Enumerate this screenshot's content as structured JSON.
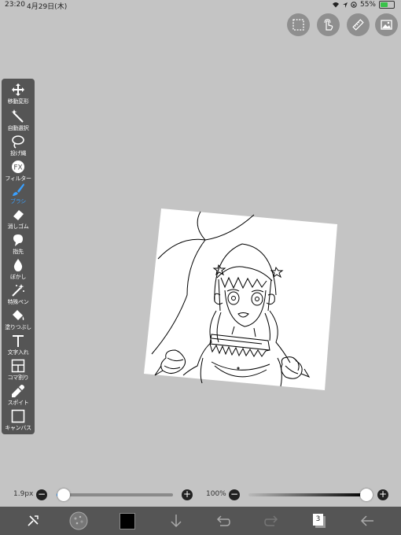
{
  "status": {
    "time": "23:20",
    "date": "4月29日(木)",
    "battery": "55%",
    "battery_level": 0.55
  },
  "top_buttons": [
    "selection-icon",
    "touch-icon",
    "ruler-icon",
    "image-icon"
  ],
  "tools": [
    {
      "label": "移動変形",
      "icon": "move-icon",
      "active": false
    },
    {
      "label": "自動選択",
      "icon": "magic-wand-icon",
      "active": false
    },
    {
      "label": "投げ縄",
      "icon": "lasso-icon",
      "active": false
    },
    {
      "label": "フィルター",
      "icon": "fx-icon",
      "active": false
    },
    {
      "label": "ブラシ",
      "icon": "brush-icon",
      "active": true
    },
    {
      "label": "消しゴム",
      "icon": "eraser-icon",
      "active": false
    },
    {
      "label": "指先",
      "icon": "finger-icon",
      "active": false
    },
    {
      "label": "ぼかし",
      "icon": "blur-icon",
      "active": false
    },
    {
      "label": "特殊ペン",
      "icon": "special-pen-icon",
      "active": false
    },
    {
      "label": "塗りつぶし",
      "icon": "fill-icon",
      "active": false
    },
    {
      "label": "文字入れ",
      "icon": "text-icon",
      "active": false
    },
    {
      "label": "コマ割り",
      "icon": "frame-icon",
      "active": false
    },
    {
      "label": "スポイト",
      "icon": "eyedropper-icon",
      "active": false
    },
    {
      "label": "キャンバス",
      "icon": "canvas-icon",
      "active": false
    }
  ],
  "brush": {
    "size_label": "1.9px",
    "size_fraction": 0.06
  },
  "opacity": {
    "label": "100%",
    "fraction": 1.0
  },
  "bottom": {
    "layer_count": "3",
    "current_color": "#000000"
  }
}
